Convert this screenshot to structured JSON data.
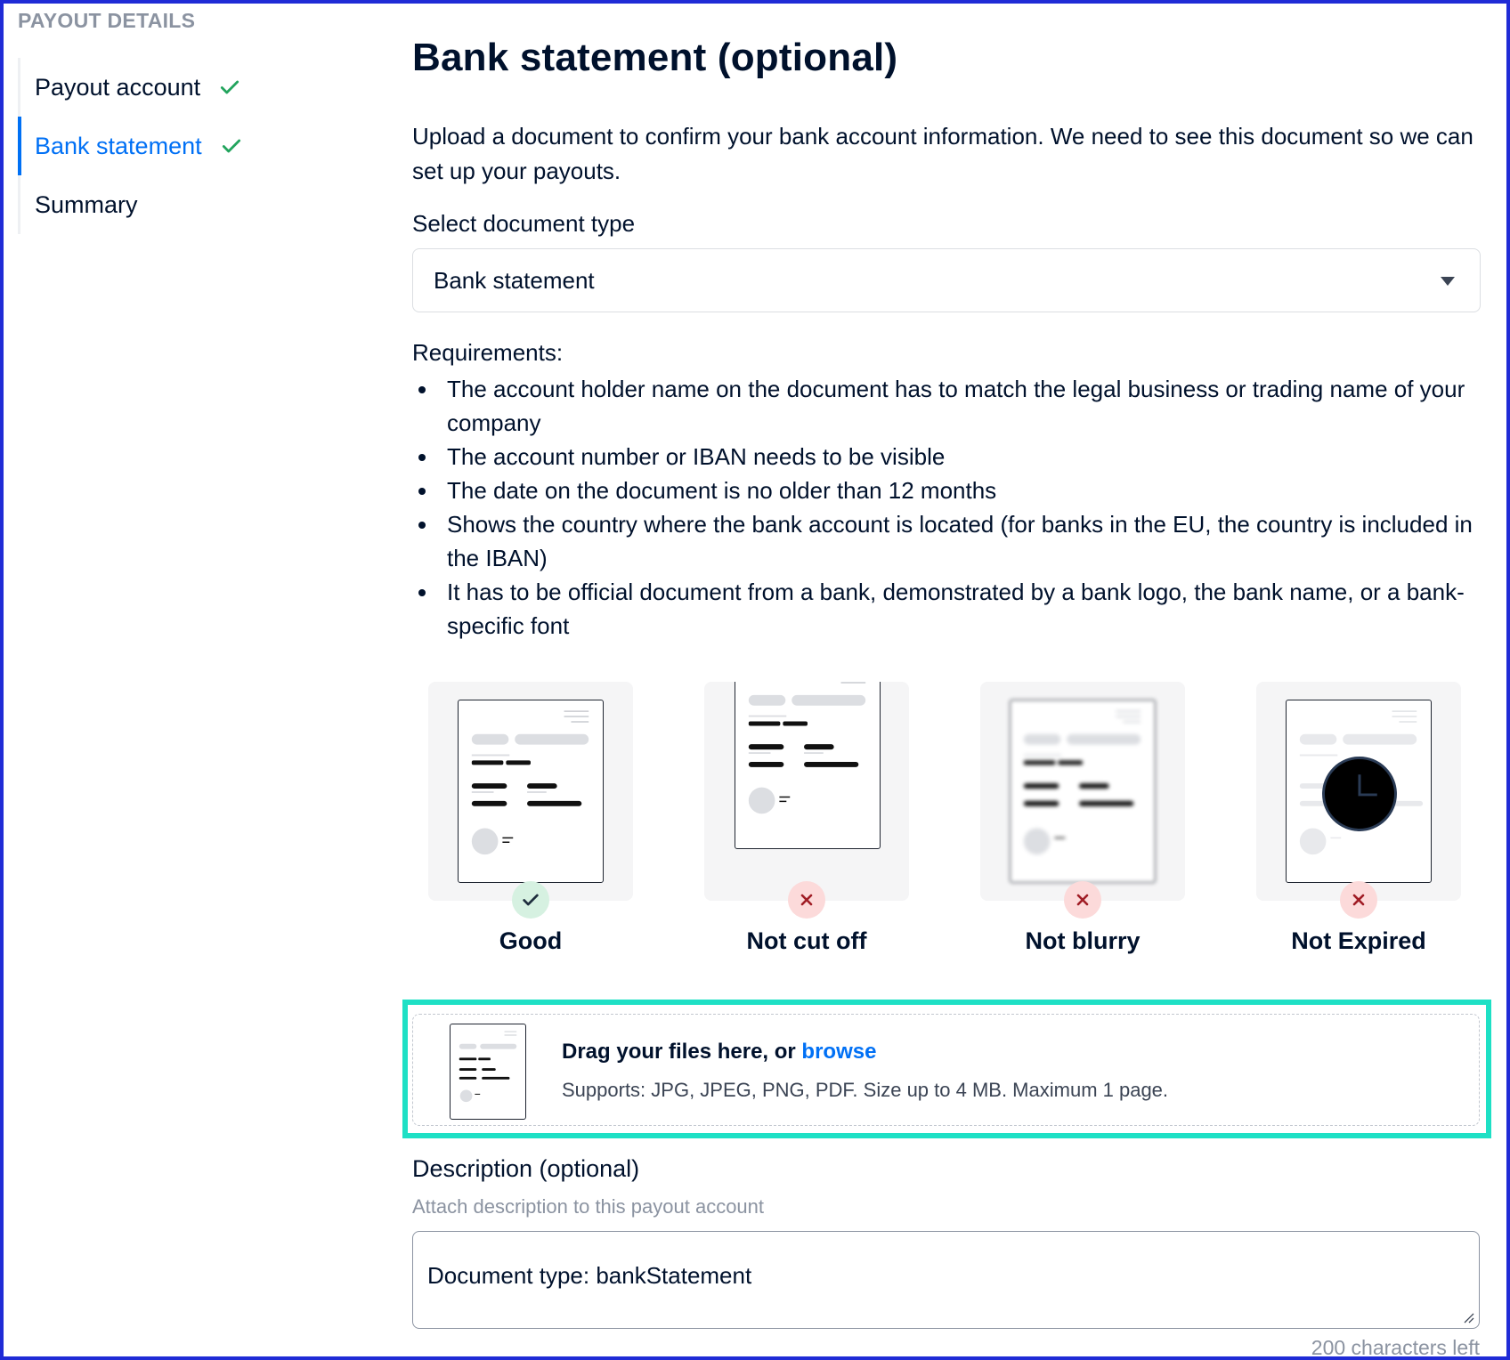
{
  "sidebar": {
    "heading": "PAYOUT DETAILS",
    "items": [
      {
        "label": "Payout account",
        "icon": "check-icon",
        "state": "complete"
      },
      {
        "label": "Bank statement",
        "icon": "check-icon",
        "state": "active"
      },
      {
        "label": "Summary",
        "state": "pending"
      }
    ]
  },
  "main": {
    "title": "Bank statement (optional)",
    "intro": "Upload a document to confirm your bank account information. We need to see this document so we can set up your payouts.",
    "document_type": {
      "label": "Select document type",
      "selected": "Bank statement",
      "icon": "caret-down-icon"
    },
    "requirements": {
      "title": "Requirements:",
      "items": [
        "The account holder name on the document has to match the legal business or trading name of your company",
        "The account number or IBAN needs to be visible",
        "The date on the document is no older than 12 months",
        "Shows the country where the bank account is located (for banks in the EU, the country is included in the IBAN)",
        "It has to be official document from a bank, demonstrated by a bank logo, the bank name, or a bank-specific font"
      ]
    },
    "examples": [
      {
        "label": "Good",
        "status": "good",
        "icon": "check-icon"
      },
      {
        "label": "Not cut off",
        "status": "bad",
        "icon": "x-icon"
      },
      {
        "label": "Not blurry",
        "status": "bad",
        "icon": "x-icon"
      },
      {
        "label": "Not Expired",
        "status": "bad",
        "icon": "x-icon"
      }
    ],
    "upload": {
      "title": "Drag your files here, or",
      "browse": "browse",
      "supports": "Supports: JPG, JPEG, PNG, PDF. Size up to 4 MB. Maximum 1 page.",
      "icon": "document-icon"
    },
    "description": {
      "label": "Description (optional)",
      "help": "Attach description to this payout account",
      "value": "Document type: bankStatement",
      "chars_left": "200 characters left"
    }
  },
  "colors": {
    "accent": "#0070f5",
    "success": "#22a45d",
    "error": "#c0202b",
    "highlight": "#1ee0c5",
    "frame": "#1f2bd6"
  }
}
